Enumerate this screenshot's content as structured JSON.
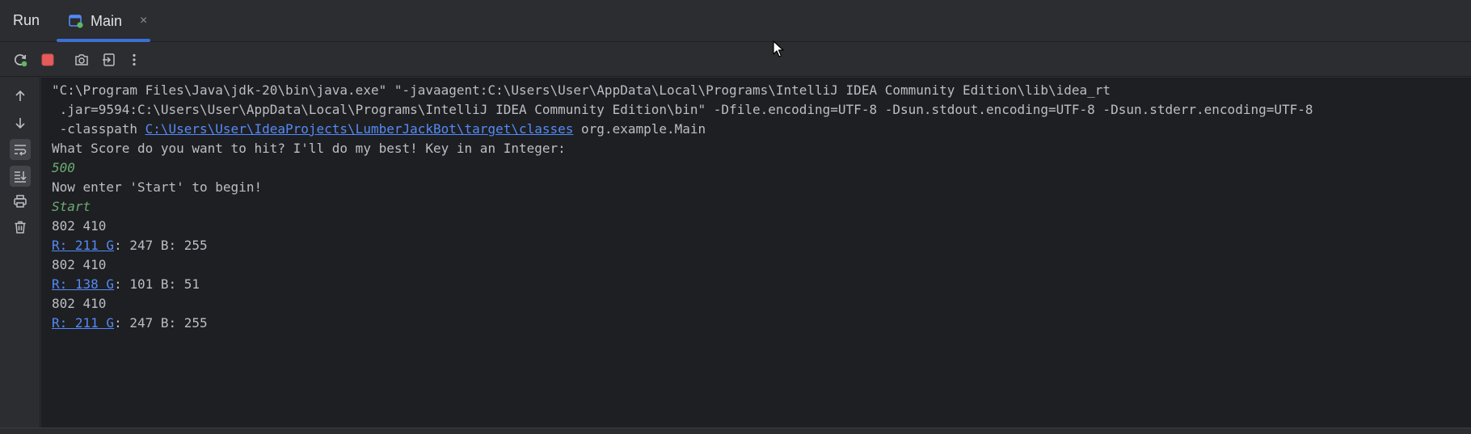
{
  "tool_window": {
    "title": "Run",
    "tab": {
      "label": "Main",
      "close": "×"
    }
  },
  "colors": {
    "background": "#1e1f22",
    "panel": "#2b2d30",
    "link": "#548af7",
    "user_input": "#6aab73",
    "stop": "#e55b5b",
    "rerun": "#5fb865"
  },
  "toolbar": {
    "icons": [
      "rerun-icon",
      "stop-icon",
      "camera-icon",
      "exit-icon",
      "more-icon"
    ]
  },
  "side_toolbar": {
    "icons": [
      "arrow-up-icon",
      "arrow-down-icon",
      "soft-wrap-icon",
      "scroll-to-end-icon",
      "print-icon",
      "trash-icon"
    ]
  },
  "console": {
    "cmd1": "\"C:\\Program Files\\Java\\jdk-20\\bin\\java.exe\" \"-javaagent:C:\\Users\\User\\AppData\\Local\\Programs\\IntelliJ IDEA Community Edition\\lib\\idea_rt",
    "cmd2": " .jar=9594:C:\\Users\\User\\AppData\\Local\\Programs\\IntelliJ IDEA Community Edition\\bin\" -Dfile.encoding=UTF-8 -Dsun.stdout.encoding=UTF-8 -Dsun.stderr.encoding=UTF-8",
    "cmd3_prefix": " -classpath ",
    "cmd3_link": "C:\\Users\\User\\IdeaProjects\\LumberJackBot\\target\\classes",
    "cmd3_suffix": " org.example.Main",
    "prompt1": "What Score do you want to hit? I'll do my best! Key in an Integer:",
    "input1": "500",
    "prompt2": "Now enter 'Start' to begin!",
    "input2": "Start",
    "out1": "802 410",
    "rgb1_link": "R: 211 G",
    "rgb1_rest": ": 247 B: 255",
    "out2": "802 410",
    "rgb2_link": "R: 138 G",
    "rgb2_rest": ": 101 B: 51",
    "out3": "802 410",
    "rgb3_link": "R: 211 G",
    "rgb3_rest": ": 247 B: 255"
  }
}
